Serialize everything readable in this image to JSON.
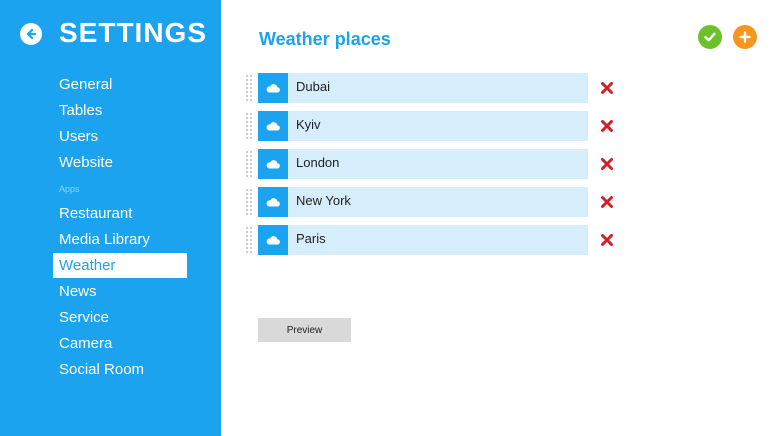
{
  "sidebar": {
    "title": "SETTINGS",
    "items": [
      {
        "label": "General"
      },
      {
        "label": "Tables"
      },
      {
        "label": "Users"
      },
      {
        "label": "Website"
      }
    ],
    "section_label": "Apps",
    "app_items": [
      {
        "label": "Restaurant"
      },
      {
        "label": "Media Library"
      },
      {
        "label": "Weather",
        "active": true
      },
      {
        "label": "News"
      },
      {
        "label": "Service"
      },
      {
        "label": "Camera"
      },
      {
        "label": "Social Room"
      }
    ]
  },
  "main": {
    "title": "Weather places",
    "places": [
      {
        "name": "Dubai"
      },
      {
        "name": "Kyiv"
      },
      {
        "name": "London"
      },
      {
        "name": "New York"
      },
      {
        "name": "Paris"
      }
    ],
    "preview_label": "Preview"
  },
  "icons": {
    "back": "arrow-left-icon",
    "confirm": "check-icon",
    "add": "plus-icon",
    "place": "cloud-icon",
    "delete": "close-icon",
    "reorder": "drag-handle-icon"
  },
  "colors": {
    "accent": "#1ba3ef",
    "row_bg": "#d6edfb",
    "confirm": "#6cc12b",
    "add": "#f5961e",
    "delete": "#d0202a"
  }
}
